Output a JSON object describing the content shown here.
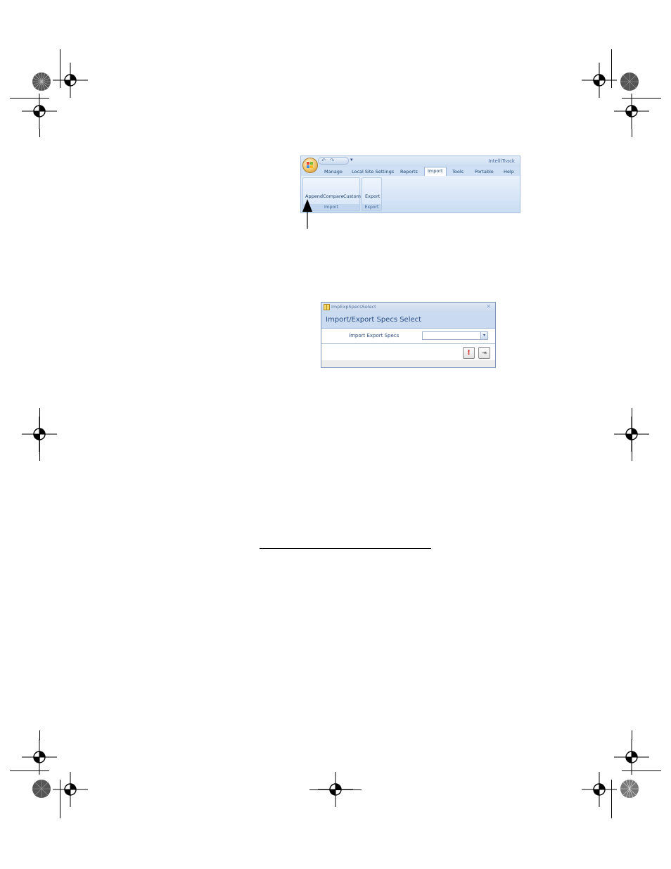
{
  "ribbon": {
    "app_title": "IntelliTrack",
    "qat_glyphs": "↶ ↷",
    "qat_more": "▾",
    "tabs": [
      "Manage",
      "Local Site Settings",
      "Reports",
      "Import",
      "Tools",
      "Portable",
      "Help"
    ],
    "active_tab": "Import",
    "groups": [
      {
        "label": "Import",
        "buttons": [
          "Append",
          "Compare",
          "Custom"
        ]
      },
      {
        "label": "Export",
        "buttons": [
          "Export"
        ]
      }
    ]
  },
  "dialog": {
    "window_title": "ImpExpSpecsSelect",
    "close_glyph": "✕",
    "header": "Import/Export Specs Select",
    "field_label": "Import Export Specs",
    "field_value": "",
    "dropdown_glyph": "▾",
    "run_glyph": "!",
    "exit_glyph": "⇥"
  },
  "colors": {
    "ribbon_bg": "#cfe0f5",
    "dialog_header": "#c9daf1",
    "run_icon": "#d11b1b"
  },
  "icons": [
    "office-orb-icon",
    "undo-icon",
    "redo-icon",
    "callout-arrow-icon",
    "form-icon",
    "close-icon",
    "dropdown-arrow-icon",
    "run-icon",
    "exit-icon",
    "registration-mark-icon",
    "sunburst-mark-icon"
  ]
}
